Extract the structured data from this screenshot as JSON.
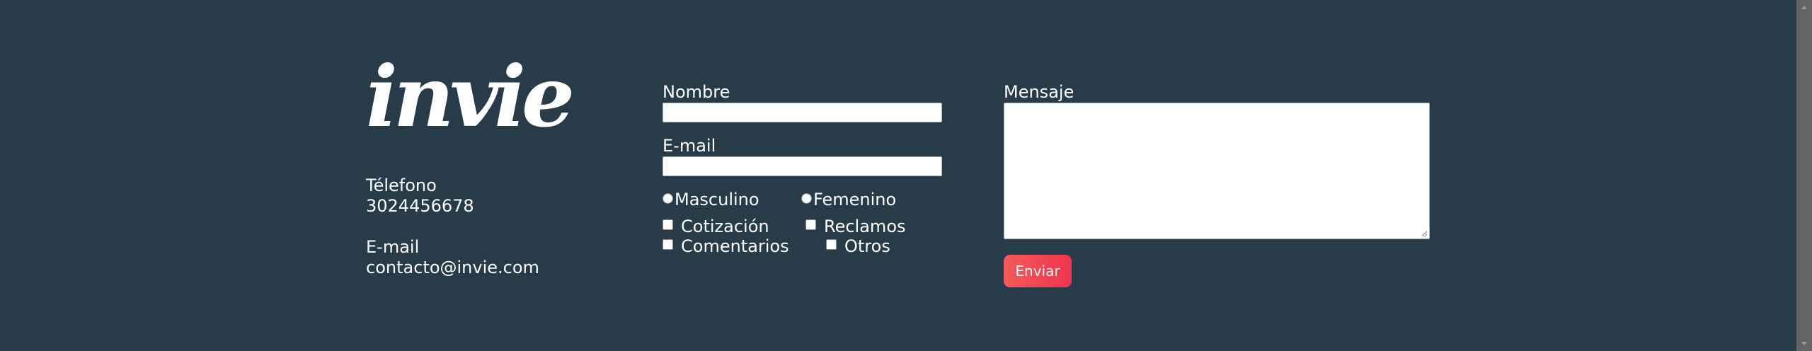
{
  "brand": {
    "logo_text": "invie"
  },
  "contact": {
    "phone_label": "Télefono",
    "phone_value": "3024456678",
    "email_label": "E-mail",
    "email_value": "contacto@invie.com"
  },
  "form": {
    "name_label": "Nombre",
    "name_value": "",
    "email_label": "E-mail",
    "email_value": "",
    "gender_options": [
      {
        "label": "Masculino",
        "checked": false
      },
      {
        "label": "Femenino",
        "checked": false
      }
    ],
    "topic_options": [
      {
        "label": "Cotización",
        "checked": false
      },
      {
        "label": "Reclamos",
        "checked": false
      },
      {
        "label": "Comentarios",
        "checked": false
      },
      {
        "label": "Otros",
        "checked": false
      }
    ],
    "message_label": "Mensaje",
    "message_value": "",
    "submit_label": "Enviar"
  },
  "colors": {
    "background": "#273b48",
    "button_gradient_start": "#f35a5a",
    "button_gradient_end": "#f2344e",
    "text": "#ffffff"
  }
}
